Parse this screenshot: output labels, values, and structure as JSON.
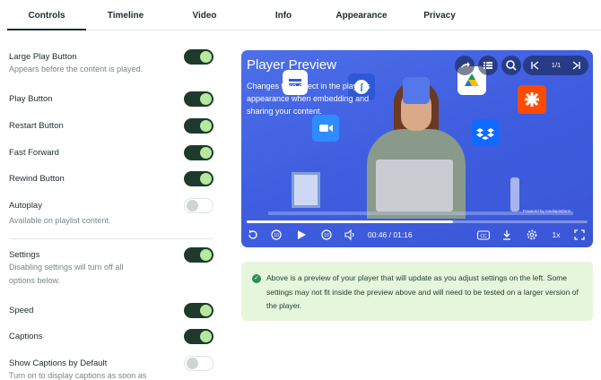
{
  "tabs": [
    {
      "label": "Controls",
      "active": true
    },
    {
      "label": "Timeline",
      "active": false
    },
    {
      "label": "Video",
      "active": false
    },
    {
      "label": "Info",
      "active": false
    },
    {
      "label": "Appearance",
      "active": false
    },
    {
      "label": "Privacy",
      "active": false
    }
  ],
  "settings": [
    {
      "label": "Large Play Button",
      "description": "Appears before the content is played.",
      "enabled": true
    },
    {
      "label": "Play Button",
      "enabled": true
    },
    {
      "label": "Restart Button",
      "enabled": true
    },
    {
      "label": "Fast Forward",
      "enabled": true
    },
    {
      "label": "Rewind Button",
      "enabled": true
    },
    {
      "label": "Autoplay",
      "description": "Available on playlist content.",
      "enabled": false
    },
    {
      "label": "Settings",
      "description": "Disabling settings will turn off all options below.",
      "enabled": true
    },
    {
      "label": "Speed",
      "enabled": true
    },
    {
      "label": "Captions",
      "enabled": true
    },
    {
      "label": "Show Captions by Default",
      "description": "Turn on to display captions as soon as",
      "enabled": false
    }
  ],
  "player": {
    "title": "Player Preview",
    "description": "Changes take effect in the player's appearance when embedding and sharing your content.",
    "page_indicator": "1/1",
    "timecode": "00:46 / 01:16",
    "progress": 0.605,
    "speed_label": "1x",
    "rewind_seconds": "10",
    "forward_seconds": "10",
    "watermark": "Powered by mediaplatform",
    "icons": {
      "share": "share-icon",
      "chapters": "list-icon",
      "search": "search-icon",
      "prev": "skip-previous-icon",
      "next": "skip-next-icon",
      "restart": "restart-icon",
      "play": "play-icon",
      "volume": "volume-icon",
      "captions": "closed-captions-icon",
      "download": "download-icon",
      "settings": "gear-icon",
      "fullscreen": "fullscreen-icon"
    },
    "brand_colors": {
      "background": "#4264e3",
      "google_drive_bg": "#ffffff",
      "zapier": "#ff4a00",
      "zoom": "#2d8cff",
      "dropbox": "#0061ff",
      "facebook": "#1877f2"
    }
  },
  "notice": {
    "text": "Above is a preview of your player that will update as you adjust settings on the left. Some settings may not fit inside the preview above and will need to be tested on a larger version of the player.",
    "icon": "check-circle-icon",
    "color": "#e6f6dd"
  },
  "accent": {
    "toggle_on": "#1d3a2c",
    "knob_on": "#b7e89e"
  }
}
